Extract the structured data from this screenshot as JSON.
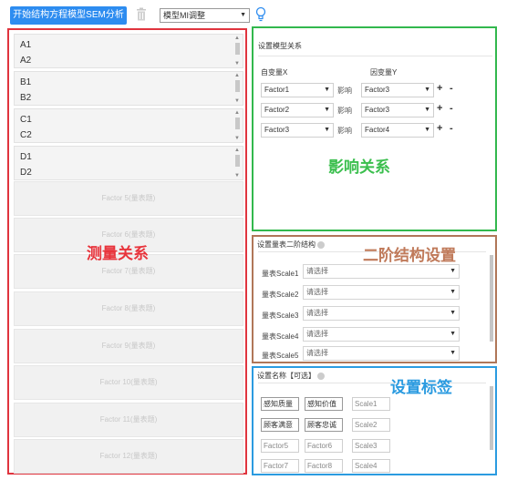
{
  "toolbar": {
    "start_button": "开始结构方程模型SEM分析",
    "model_select": "模型MI调整"
  },
  "measurement": {
    "label": "测量关系",
    "groups": [
      {
        "items": [
          "A1",
          "A2"
        ]
      },
      {
        "items": [
          "B1",
          "B2"
        ]
      },
      {
        "items": [
          "C1",
          "C2"
        ]
      },
      {
        "items": [
          "D1",
          "D2"
        ]
      }
    ],
    "factor_slots": [
      "Factor 5(量表题)",
      "Factor 6(量表题)",
      "Factor 7(量表题)",
      "Factor 8(量表题)",
      "Factor 9(量表题)",
      "Factor 10(量表题)",
      "Factor 11(量表题)",
      "Factor 12(量表题)"
    ]
  },
  "influence": {
    "title": "设置模型关系",
    "col_x": "自变量X",
    "col_y": "因变量Y",
    "verb": "影响",
    "rows": [
      {
        "x": "Factor1",
        "y": "Factor3"
      },
      {
        "x": "Factor2",
        "y": "Factor3"
      },
      {
        "x": "Factor3",
        "y": "Factor4"
      }
    ],
    "plus": "+",
    "minus": "-",
    "label": "影响关系"
  },
  "second_order": {
    "title": "设置量表二阶结构",
    "label": "二阶结构设置",
    "placeholder": "请选择",
    "scales": [
      "量表Scale1",
      "量表Scale2",
      "量表Scale3",
      "量表Scale4",
      "量表Scale5"
    ]
  },
  "tags": {
    "title": "设置名称【可选】",
    "label": "设置标签",
    "rows": [
      [
        "感知质量",
        "感知价值",
        "Scale1"
      ],
      [
        "顾客满意",
        "顾客忠诚",
        "Scale2"
      ],
      [
        "Factor5",
        "Factor6",
        "Scale3"
      ],
      [
        "Factor7",
        "Factor8",
        "Scale4"
      ]
    ]
  }
}
